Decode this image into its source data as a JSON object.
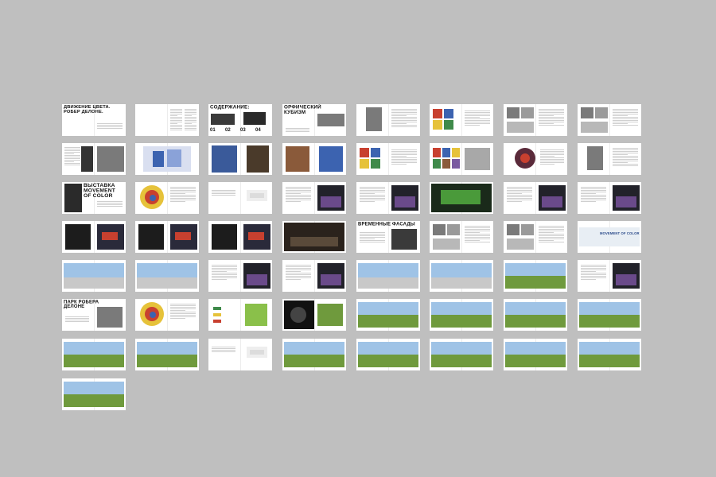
{
  "page": {
    "background": "#bfbfbf",
    "spread_color": "#ffffff"
  },
  "texts": {
    "t1": "ДВИЖЕНИЕ ЦВЕТА.\nРОБЕР ДЕЛОНЕ.",
    "t2": "СОДЕРЖАНИЕ:",
    "t2_nums": [
      "01",
      "02",
      "03",
      "04"
    ],
    "t3": "ОРФИЧЕСКИЙ\nКУБИЗМ",
    "t4": "ВЫСТАВКА\nMOVEMENT\nOF COLOR",
    "t5": "ВРЕМЕННЫЕ ФАСАДЫ",
    "t6": "ПАРК РОБЕРА\nДЕЛОНЕ",
    "t7": "MOVEMENT OF COLOR"
  },
  "palette": {
    "photo_gray": "#7a7a7a",
    "photo_dark": "#1c1c1c",
    "sky": "#9fc3e6",
    "grass": "#6f9a3d",
    "red": "#c8402f",
    "yellow": "#e6c23a",
    "blue": "#3c63b0",
    "green": "#3f8a4a",
    "brown": "#8a5a3a"
  },
  "spreads": [
    {
      "kind": "title",
      "text": "t1"
    },
    {
      "kind": "text_only"
    },
    {
      "kind": "contents"
    },
    {
      "kind": "title_photo",
      "text": "t3"
    },
    {
      "kind": "portrait_text"
    },
    {
      "kind": "paintings_text"
    },
    {
      "kind": "photos_text"
    },
    {
      "kind": "photos_text"
    },
    {
      "kind": "text_bw_photos"
    },
    {
      "kind": "colorful_art"
    },
    {
      "kind": "cathedral"
    },
    {
      "kind": "paintings_pair"
    },
    {
      "kind": "paintings_text"
    },
    {
      "kind": "gallery_grid"
    },
    {
      "kind": "disc_art"
    },
    {
      "kind": "portrait_text"
    },
    {
      "kind": "exhibit_title",
      "text": "t4"
    },
    {
      "kind": "circle_art"
    },
    {
      "kind": "sketch"
    },
    {
      "kind": "night_render"
    },
    {
      "kind": "night_render"
    },
    {
      "kind": "night_render_green"
    },
    {
      "kind": "night_render"
    },
    {
      "kind": "night_render"
    },
    {
      "kind": "night_interior"
    },
    {
      "kind": "night_interior"
    },
    {
      "kind": "night_interior"
    },
    {
      "kind": "hall_dark"
    },
    {
      "kind": "facades_title",
      "text": "t5"
    },
    {
      "kind": "photos_text"
    },
    {
      "kind": "photos_text"
    },
    {
      "kind": "banner",
      "text": "t7"
    },
    {
      "kind": "sky_render"
    },
    {
      "kind": "sky_render"
    },
    {
      "kind": "night_render"
    },
    {
      "kind": "night_render"
    },
    {
      "kind": "sky_render"
    },
    {
      "kind": "sky_render"
    },
    {
      "kind": "grass_render"
    },
    {
      "kind": "night_render"
    },
    {
      "kind": "park_title",
      "text": "t6"
    },
    {
      "kind": "circle_art"
    },
    {
      "kind": "plan_diagram"
    },
    {
      "kind": "plan_dark"
    },
    {
      "kind": "grass_render"
    },
    {
      "kind": "grass_render"
    },
    {
      "kind": "grass_render"
    },
    {
      "kind": "grass_render"
    },
    {
      "kind": "grass_render"
    },
    {
      "kind": "grass_render"
    },
    {
      "kind": "sketch"
    },
    {
      "kind": "grass_render"
    },
    {
      "kind": "grass_render"
    },
    {
      "kind": "grass_render"
    },
    {
      "kind": "grass_render"
    },
    {
      "kind": "grass_render"
    },
    {
      "kind": "grass_render"
    }
  ]
}
